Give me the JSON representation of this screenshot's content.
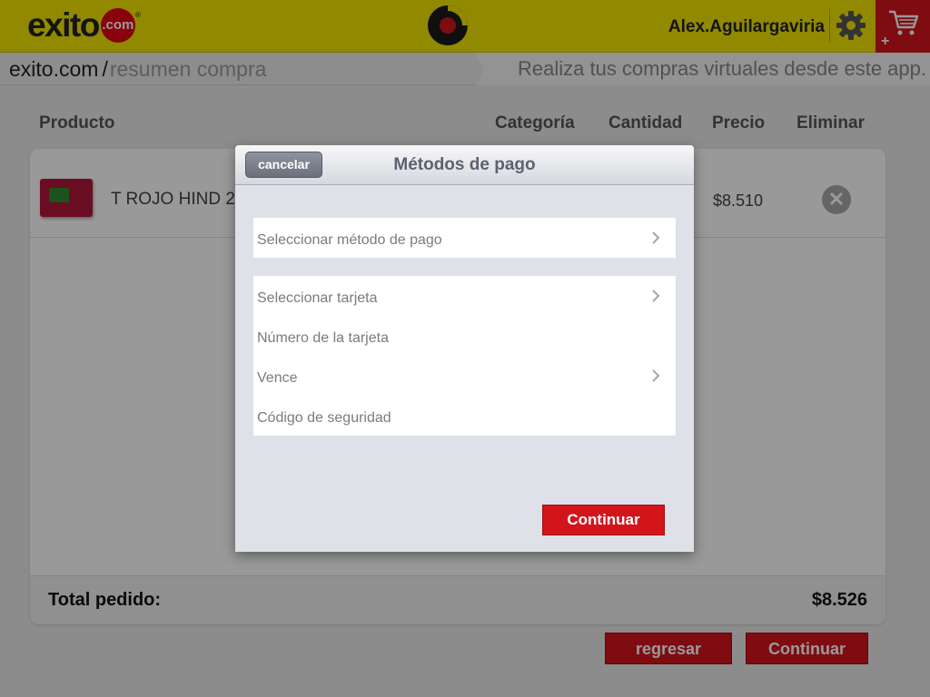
{
  "header": {
    "logo_text": "exito",
    "logo_dot_text": ".com",
    "logo_reg": "®",
    "username": "Alex.Aguilargaviria",
    "cart_plus": "+"
  },
  "breadcrumb": {
    "home": "exito.com",
    "separator": "/",
    "current": "resumen compra",
    "tagline": "Realiza tus compras virtuales desde este app."
  },
  "cart": {
    "columns": {
      "product": "Producto",
      "category": "Categoría",
      "quantity": "Cantidad",
      "price": "Precio",
      "remove": "Eliminar"
    },
    "items": [
      {
        "name": "T ROJO HIND 2",
        "price": "$8.510",
        "remove_symbol": "✕"
      }
    ],
    "total_label": "Total pedido:",
    "total_value": "$8.526",
    "back_label": "regresar",
    "continue_label": "Continuar"
  },
  "modal": {
    "cancel_label": "cancelar",
    "title": "Métodos de pago",
    "method_field": "Seleccionar método de pago",
    "card_fields": [
      "Seleccionar tarjeta",
      "Número de la tarjeta",
      "Vence",
      "Código de seguridad"
    ],
    "continue_label": "Continuar"
  },
  "colors": {
    "header_yellow": "#f2e500",
    "brand_red": "#d3141b",
    "text_dark": "#222222"
  },
  "icons": [
    "spinner-icon",
    "gear-icon",
    "cart-icon",
    "remove-icon",
    "chevron-right-icon"
  ]
}
